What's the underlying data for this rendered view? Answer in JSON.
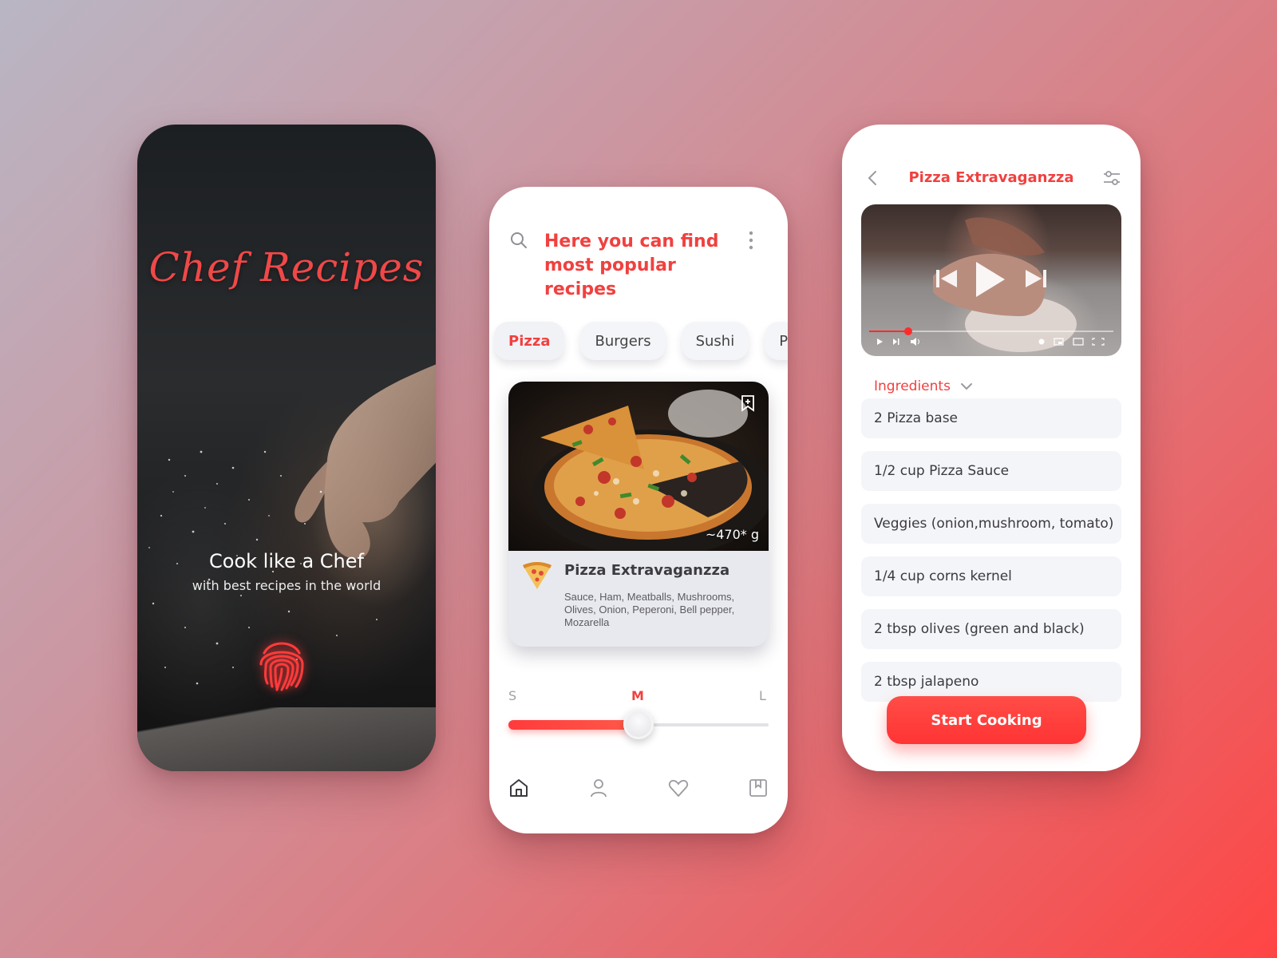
{
  "colors": {
    "accent": "#f0413f",
    "button": "#ff3b3b",
    "chip_bg": "#f4f5f8",
    "text_dark": "#3b3b40"
  },
  "screen1": {
    "brand_title": "Chef Recipes",
    "headline": "Cook like a Chef",
    "subheadline": "with best recipes in the world",
    "icons": [
      "fingerprint-icon"
    ]
  },
  "screen2": {
    "title": "Here you can find most popular recipes",
    "icons": [
      "search-icon",
      "more-vertical-icon",
      "bookmark-add-icon",
      "pizza-slice-icon",
      "home-icon",
      "user-icon",
      "heart-icon",
      "bookmark-icon"
    ],
    "categories": [
      {
        "label": "",
        "active": false
      },
      {
        "label": "Pizza",
        "active": true
      },
      {
        "label": "Burgers",
        "active": false
      },
      {
        "label": "Sushi",
        "active": false
      },
      {
        "label": "Pa",
        "active": false
      }
    ],
    "recipe": {
      "name": "Pizza Extravaganzza",
      "weight": "~470* g",
      "ingredients": "Sauce, Ham, Meatballs, Mushrooms, Olives, Onion, Peperoni, Bell pepper, Mozarella"
    },
    "sizes": [
      "S",
      "M",
      "L"
    ],
    "selected_size": "M",
    "size_slider_level": 0.5
  },
  "screen3": {
    "title": "Pizza Extravaganzza",
    "icons": [
      "back-icon",
      "filter-sliders-icon",
      "skip-previous-icon",
      "play-icon",
      "skip-next-icon",
      "settings-icon",
      "miniplayer-icon",
      "theater-icon",
      "fullscreen-icon",
      "volume-icon"
    ],
    "video_progress": 0.16,
    "ingredients_label": "Ingredients",
    "ingredients": [
      "2 Pizza base",
      "1/2 cup Pizza Sauce",
      "Veggies (onion,mushroom, tomato)",
      "1/4 cup corns kernel",
      "2 tbsp olives (green and black)",
      "2 tbsp jalapeno"
    ],
    "start_button": "Start Cooking"
  }
}
